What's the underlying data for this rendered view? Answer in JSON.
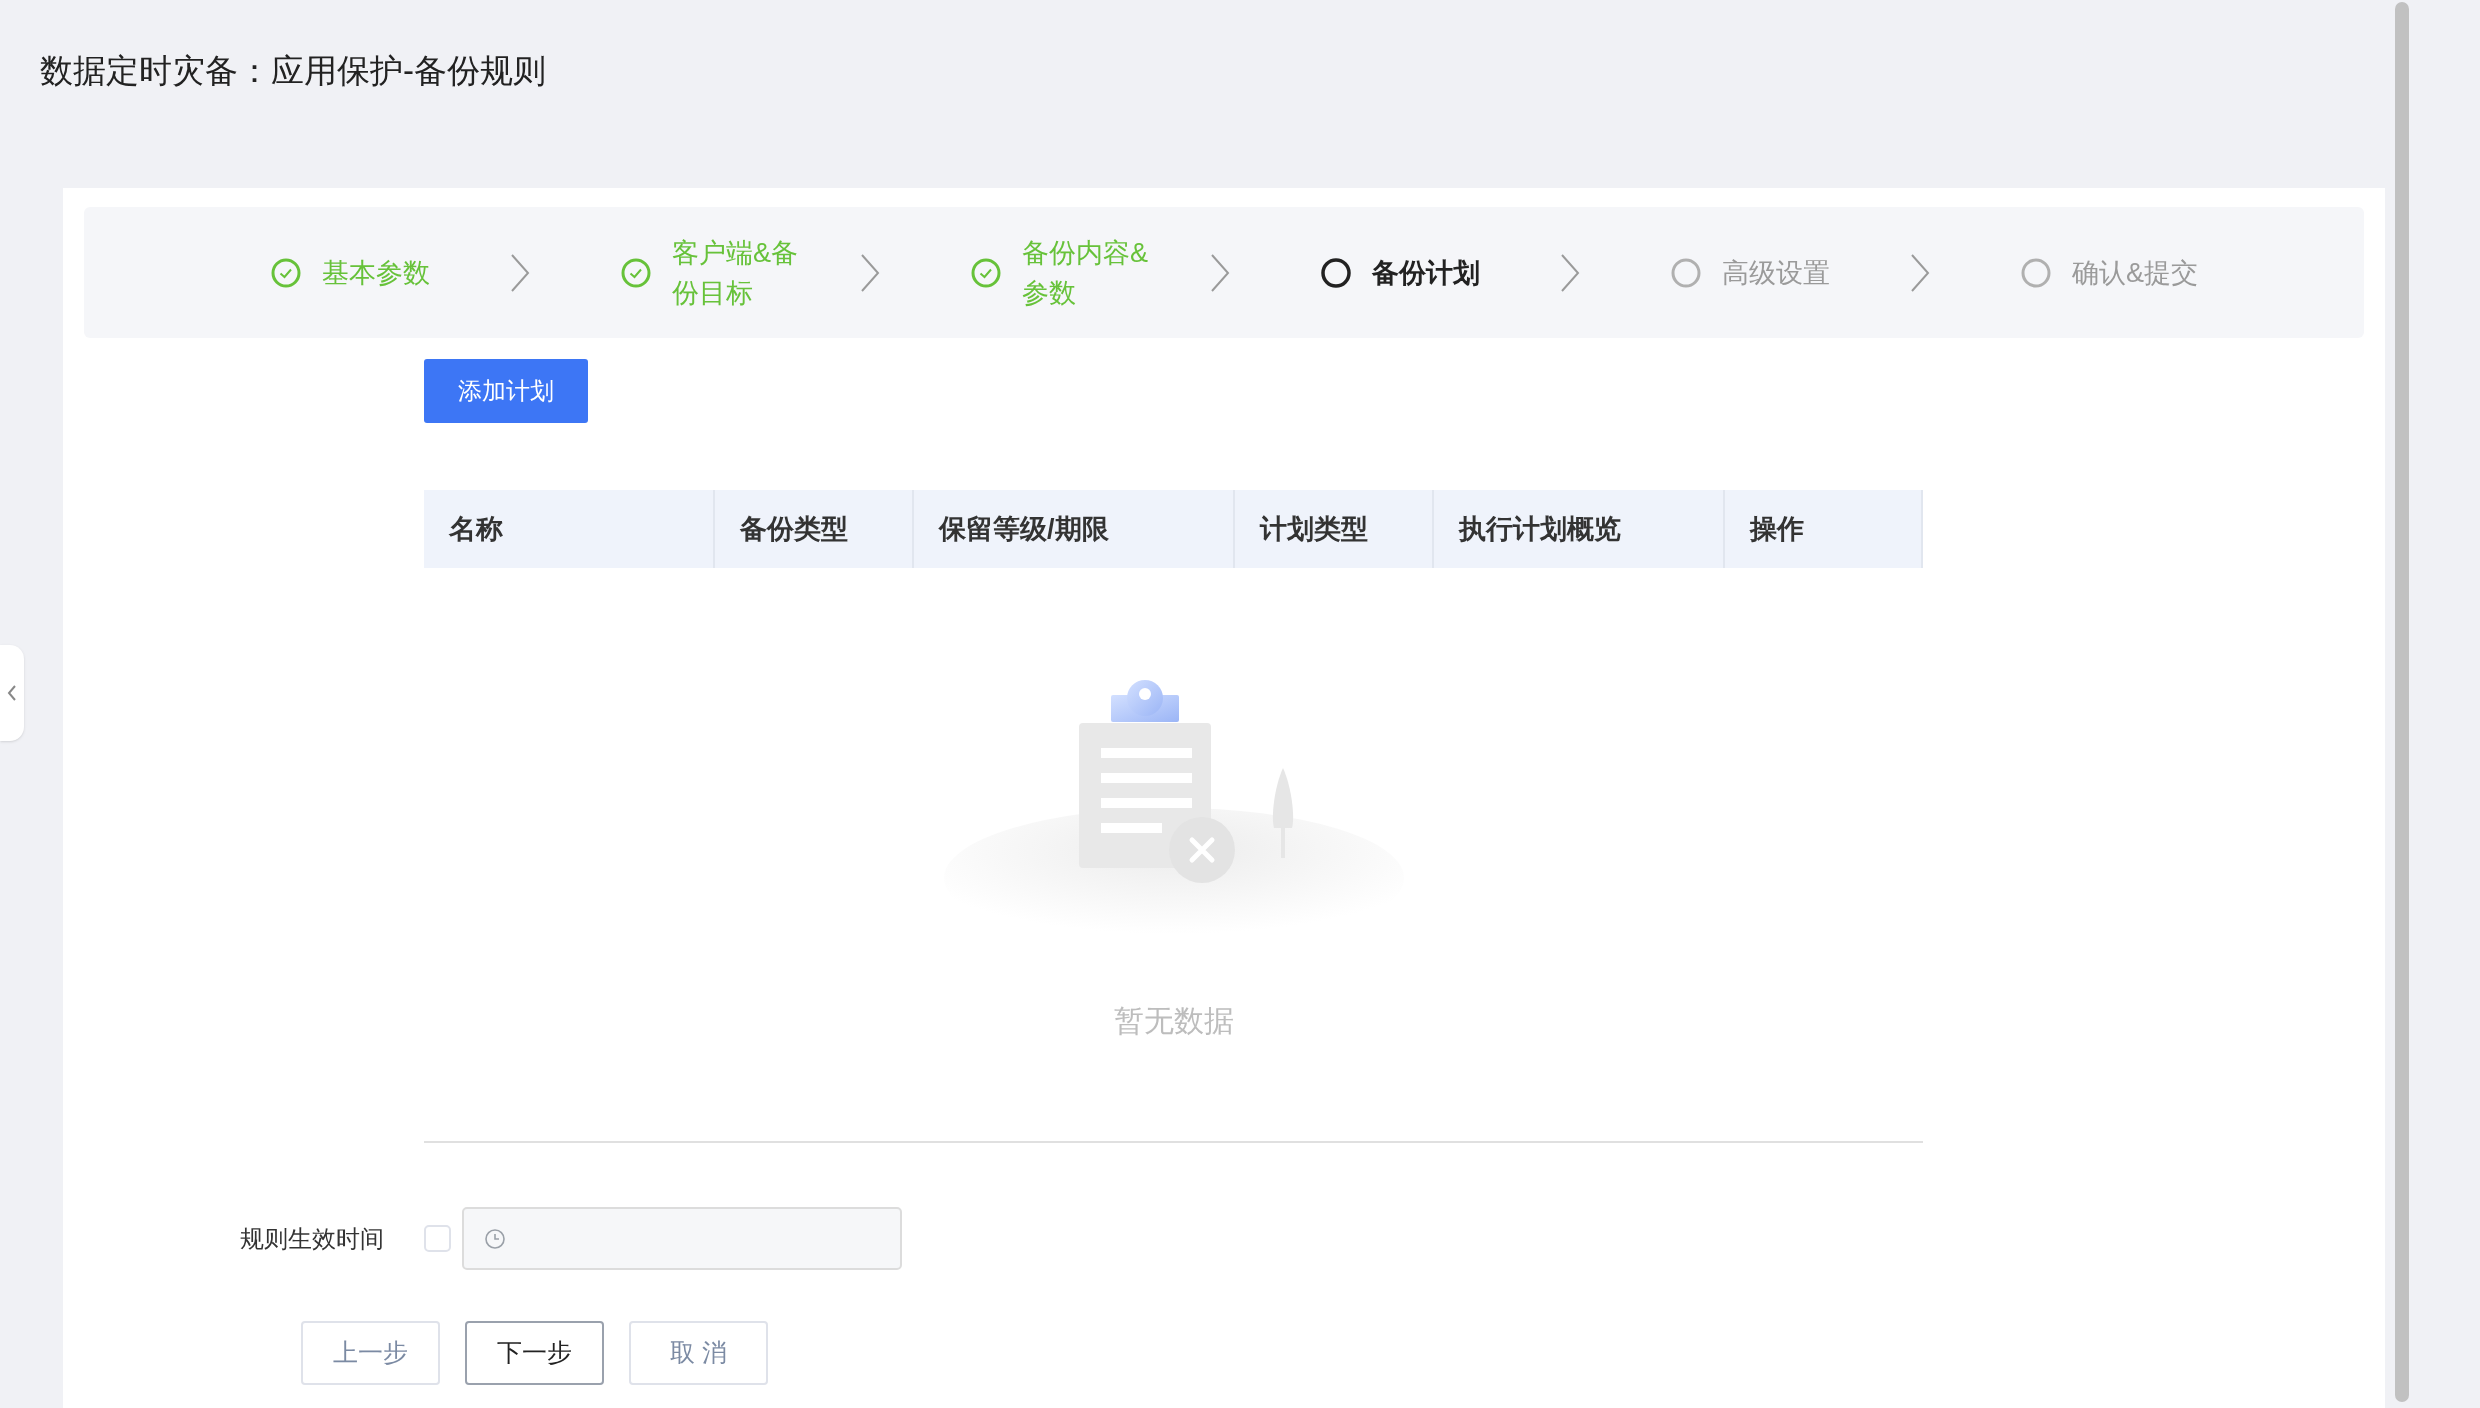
{
  "page_title": "数据定时灾备：应用保护-备份规则",
  "steps": [
    {
      "label": "基本参数",
      "kind": "done"
    },
    {
      "label": "客户端&备份目标",
      "kind": "done"
    },
    {
      "label": "备份内容&参数",
      "kind": "done"
    },
    {
      "label": "备份计划",
      "kind": "active"
    },
    {
      "label": "高级设置",
      "kind": "pending"
    },
    {
      "label": "确认&提交",
      "kind": "pending"
    }
  ],
  "add_button": "添加计划",
  "table": {
    "columns": [
      "名称",
      "备份类型",
      "保留等级/期限",
      "计划类型",
      "执行计划概览",
      "操作"
    ],
    "empty_text": "暂无数据"
  },
  "rule_time": {
    "label": "规则生效时间",
    "checked": false
  },
  "buttons": [
    {
      "label": "上一步",
      "kind": "secondary"
    },
    {
      "label": "下一步",
      "kind": "primary"
    },
    {
      "label": "取 消",
      "kind": "secondary"
    }
  ]
}
